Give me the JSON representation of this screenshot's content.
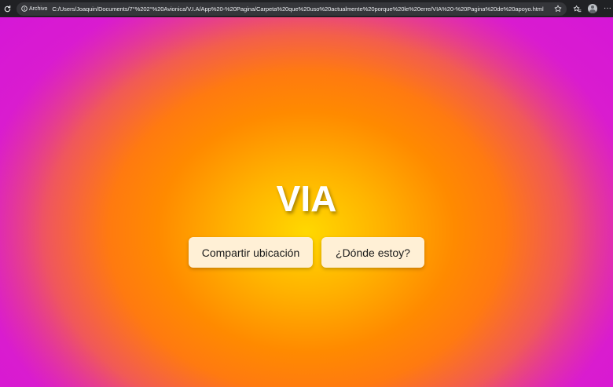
{
  "browser": {
    "info_label": "Archivo",
    "url": "C:/Users/Joaquin/Documents/7°%202°%20Avionica/V.I.A/App%20-%20Pagina/Carpeta%20que%20uso%20actualmente%20porque%20le%20erre/VIA%20-%20Pagina%20de%20apoyo.html",
    "menu_label": "···",
    "icons": [
      "reload-icon",
      "info-icon",
      "star-icon",
      "favorites-icon",
      "profile-avatar",
      "menu-icon"
    ]
  },
  "page": {
    "title": "VIA",
    "share_location_label": "Compartir ubicación",
    "where_am_i_label": "¿Dónde estoy?"
  },
  "colors": {
    "center": "#ffd800",
    "mid": "#ff8a00",
    "edge": "#dc20c8",
    "button_bg": "#fff0d6",
    "browser_bar": "#202124"
  }
}
